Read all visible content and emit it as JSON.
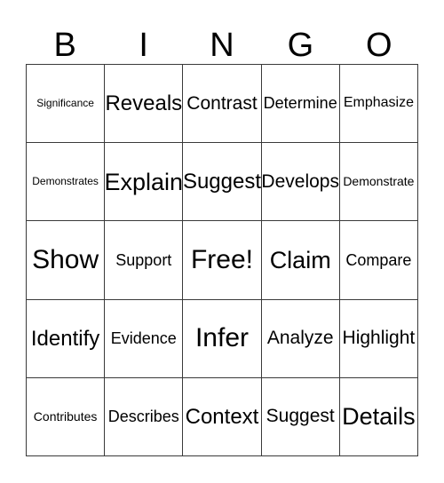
{
  "card": {
    "title_letters": [
      "B",
      "I",
      "N",
      "G",
      "O"
    ],
    "columns": 5,
    "rows": 5,
    "free_space": "Free!",
    "free_space_position": {
      "row": 3,
      "column": 3
    },
    "colors": {
      "background": "#ffffff",
      "text": "#000000",
      "grid_line": "#3a3a3a"
    },
    "grid": [
      [
        {
          "label": "Significance",
          "size": "fs-xs"
        },
        {
          "label": "Reveals",
          "size": "fs-xxl"
        },
        {
          "label": "Contrast",
          "size": "fs-xl"
        },
        {
          "label": "Determine",
          "size": "fs-lg"
        },
        {
          "label": "Emphasize",
          "size": "fs-md"
        }
      ],
      [
        {
          "label": "Demonstrates",
          "size": "fs-xs"
        },
        {
          "label": "Explain",
          "size": "fs-huge"
        },
        {
          "label": "Suggest",
          "size": "fs-xxl"
        },
        {
          "label": "Develops",
          "size": "fs-xl"
        },
        {
          "label": "Demonstrate",
          "size": "fs-sm"
        }
      ],
      [
        {
          "label": "Show",
          "size": "fs-max"
        },
        {
          "label": "Support",
          "size": "fs-lg"
        },
        {
          "label": "Free!",
          "size": "fs-max"
        },
        {
          "label": "Claim",
          "size": "fs-huge"
        },
        {
          "label": "Compare",
          "size": "fs-lg"
        }
      ],
      [
        {
          "label": "Identify",
          "size": "fs-xxl"
        },
        {
          "label": "Evidence",
          "size": "fs-lg"
        },
        {
          "label": "Infer",
          "size": "fs-max"
        },
        {
          "label": "Analyze",
          "size": "fs-xl"
        },
        {
          "label": "Highlight",
          "size": "fs-xl"
        }
      ],
      [
        {
          "label": "Contributes",
          "size": "fs-sm"
        },
        {
          "label": "Describes",
          "size": "fs-lg"
        },
        {
          "label": "Context",
          "size": "fs-xxl"
        },
        {
          "label": "Suggest",
          "size": "fs-xl"
        },
        {
          "label": "Details",
          "size": "fs-huge"
        }
      ]
    ]
  }
}
